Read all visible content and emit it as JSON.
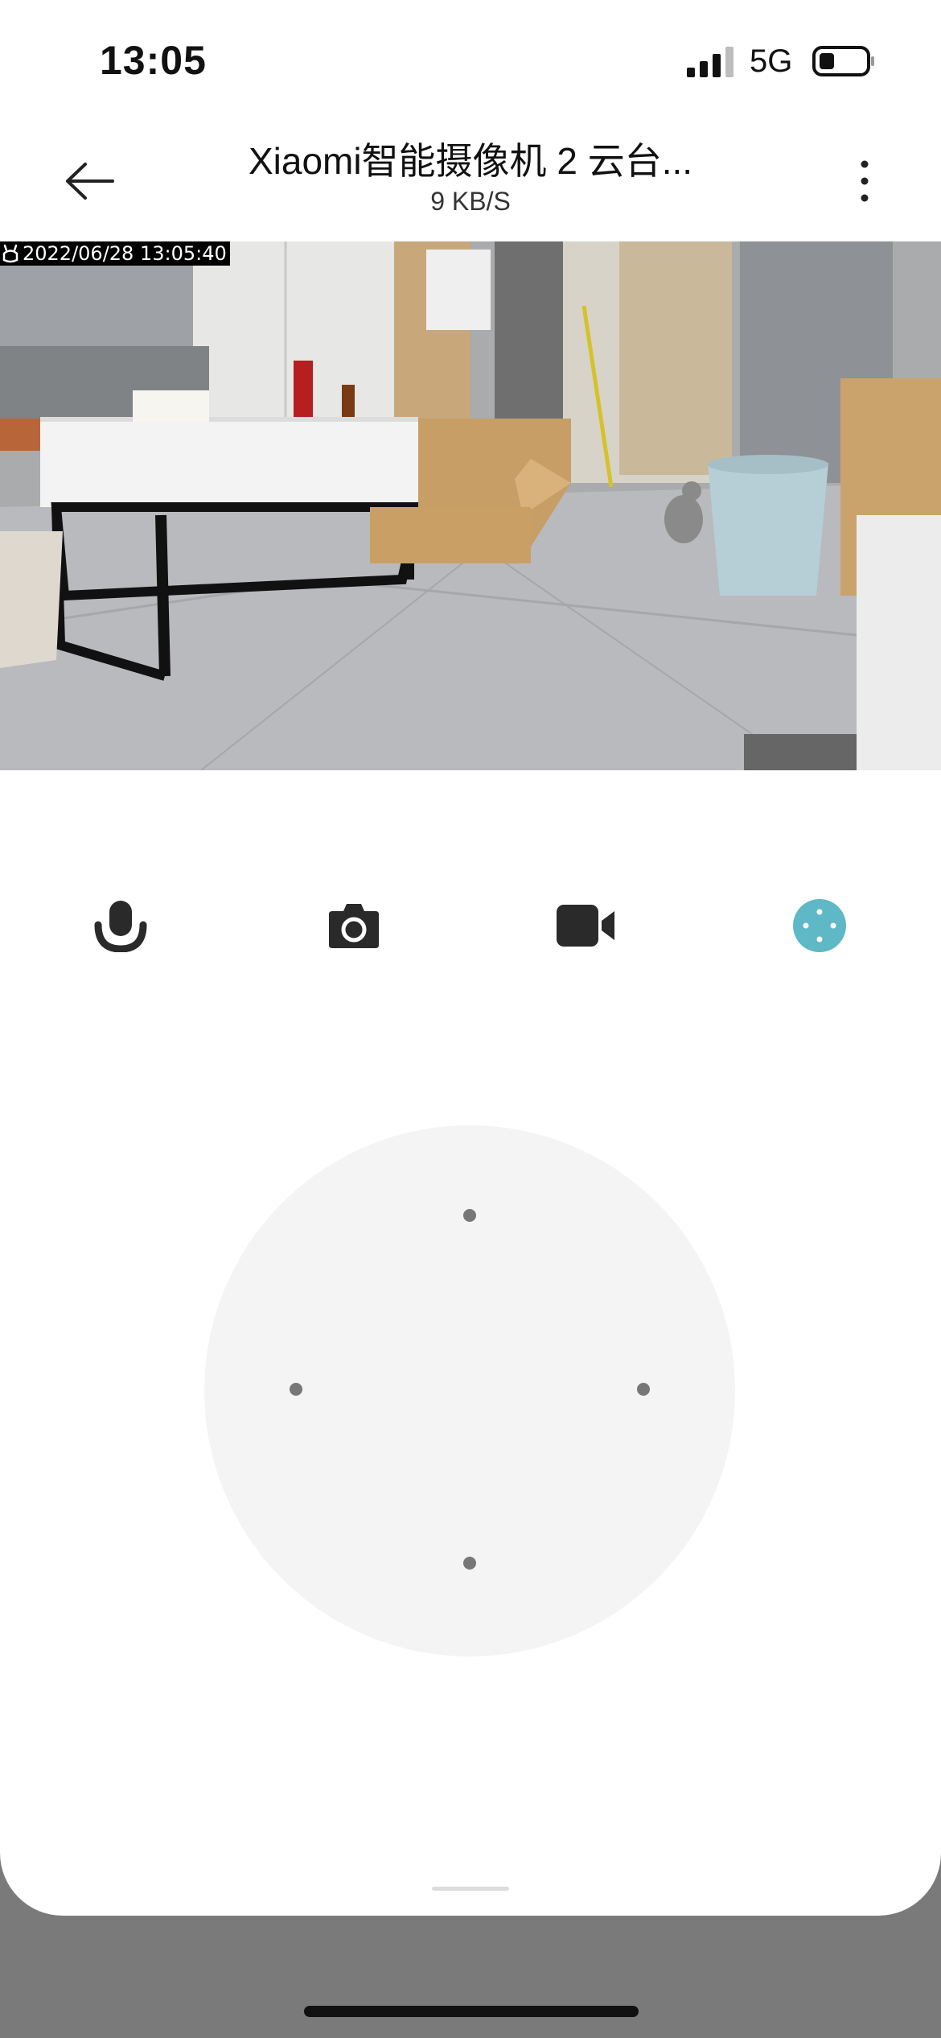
{
  "status_bar": {
    "time": "13:05",
    "network": "5G",
    "icons": [
      "cellular-signal-icon",
      "battery-icon"
    ]
  },
  "header": {
    "title": "Xiaomi智能摄像机 2 云台...",
    "subtitle": "9 KB/S",
    "icons": [
      "back-arrow-icon",
      "more-vertical-icon"
    ]
  },
  "video": {
    "timestamp": "2022/06/28 13:05:40",
    "brand_icon": "mi-bunny-icon"
  },
  "toolbar": {
    "icons": [
      "microphone-icon",
      "camera-snapshot-icon",
      "video-record-icon",
      "ptz-control-icon"
    ],
    "active_color": "#5fb8c6"
  },
  "joystick": {
    "directions": [
      "up",
      "left",
      "right",
      "down"
    ]
  }
}
